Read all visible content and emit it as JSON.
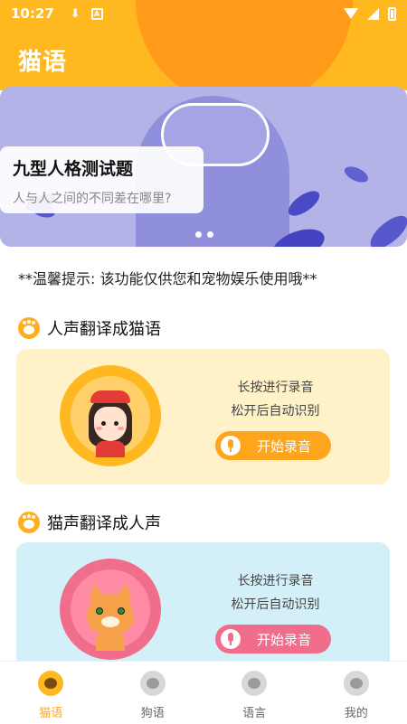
{
  "status": {
    "time": "10:27"
  },
  "header": {
    "title": "猫语"
  },
  "banner": {
    "title": "九型人格测试题",
    "subtitle": "人与人之间的不同差在哪里?"
  },
  "tip": "**温馨提示: 该功能仅供您和宠物娱乐使用哦**",
  "section1": {
    "title": "人声翻译成猫语",
    "hint_line1": "长按进行录音",
    "hint_line2": "松开后自动识别",
    "button": "开始录音"
  },
  "section2": {
    "title": "猫声翻译成人声",
    "hint_line1": "长按进行录音",
    "hint_line2": "松开后自动识别",
    "button": "开始录音"
  },
  "nav": {
    "items": [
      {
        "label": "猫语",
        "icon": "cat-icon",
        "active": true
      },
      {
        "label": "狗语",
        "icon": "dog-icon",
        "active": false
      },
      {
        "label": "语言",
        "icon": "paw-icon",
        "active": false
      },
      {
        "label": "我的",
        "icon": "profile-icon",
        "active": false
      }
    ]
  },
  "colors": {
    "accent": "#ffa51d",
    "pink": "#f06d8b",
    "yellow_panel": "#fff2c9",
    "blue_panel": "#d3f0f8"
  }
}
